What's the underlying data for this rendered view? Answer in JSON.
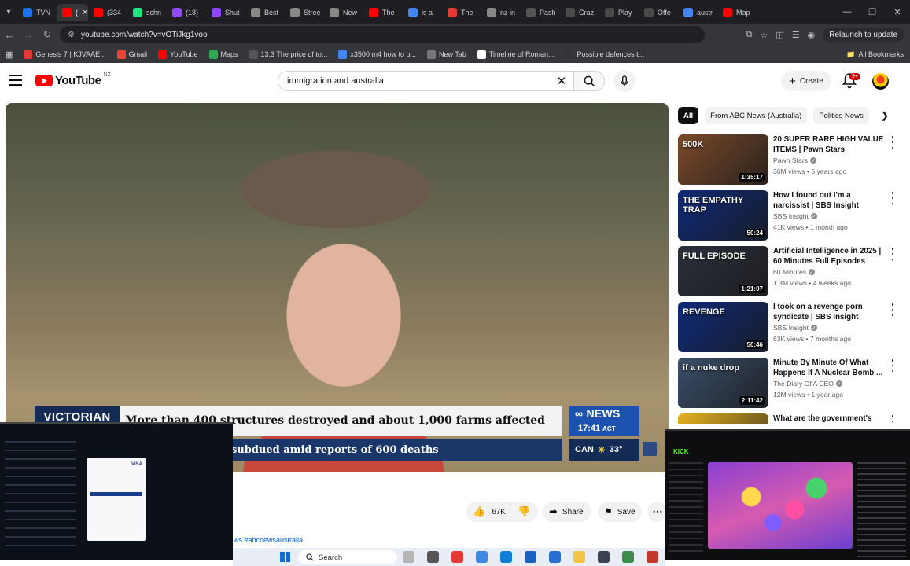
{
  "browser": {
    "tabs": [
      {
        "label": "TVN",
        "color": "#1a73e8"
      },
      {
        "label": "(",
        "color": "#ff0000",
        "active": true
      },
      {
        "label": "(334",
        "color": "#ff0000"
      },
      {
        "label": "schn",
        "color": "#1ce783"
      },
      {
        "label": "(18)",
        "color": "#9146ff"
      },
      {
        "label": "Shut",
        "color": "#9146ff"
      },
      {
        "label": "Best",
        "color": "#888888"
      },
      {
        "label": "Stree",
        "color": "#888888"
      },
      {
        "label": "New",
        "color": "#888888"
      },
      {
        "label": "The",
        "color": "#ff0000"
      },
      {
        "label": "is a",
        "color": "#4285f4"
      },
      {
        "label": "The",
        "color": "#e53935"
      },
      {
        "label": "nz in",
        "color": "#888888"
      },
      {
        "label": "Pash",
        "color": "#555555"
      },
      {
        "label": "Craz",
        "color": "#4a4a4a"
      },
      {
        "label": "Play",
        "color": "#4a4a4a"
      },
      {
        "label": "Offe",
        "color": "#4a4a4a"
      },
      {
        "label": "austr",
        "color": "#4285f4"
      },
      {
        "label": "Map",
        "color": "#ff0000"
      }
    ],
    "url": "youtube.com/watch?v=vOTiJkg1voo",
    "relaunch_label": "Relaunch to update",
    "bookmarks": [
      {
        "label": "Genesis 7 | KJVAAE...",
        "color": "#e53935"
      },
      {
        "label": "Gmail",
        "color": "#ea4335"
      },
      {
        "label": "YouTube",
        "color": "#ff0000"
      },
      {
        "label": "Maps",
        "color": "#34a853"
      },
      {
        "label": "13.3 The price of to...",
        "color": "#555555"
      },
      {
        "label": "x3500 m4 how to u...",
        "color": "#4285f4"
      },
      {
        "label": "New Tab",
        "color": "#777777"
      },
      {
        "label": "Timeline of Roman...",
        "color": "#ffffff"
      },
      {
        "label": "Possible defences t...",
        "color": "#333333"
      }
    ],
    "all_bookmarks_label": "All Bookmarks"
  },
  "youtube": {
    "logo_text": "YouTube",
    "region": "NZ",
    "search_value": "immigration and australia",
    "create_label": "Create",
    "notif_badge": "9+"
  },
  "player": {
    "lower_third_tag": "VICTORIAN",
    "headline": "More than 400 structures destroyed and about 1,000 farms affected",
    "subheadline": "subdued amid reports of 600 deaths",
    "brand": "NEWS",
    "time": "17:41",
    "timezone": "ACT",
    "weather_place": "CAN",
    "weather_temp": "33°"
  },
  "description": {
    "hashtags": "ws #abcnewsaustralia"
  },
  "actions": {
    "likes": "67K",
    "share_label": "Share",
    "save_label": "Save"
  },
  "chips": [
    {
      "label": "All",
      "active": true
    },
    {
      "label": "From ABC News (Australia)"
    },
    {
      "label": "Politics News"
    }
  ],
  "recommendations": [
    {
      "title": "20 SUPER RARE HIGH VALUE ITEMS | Pawn Stars",
      "channel": "Pawn Stars",
      "meta": "36M views • 5 years ago",
      "duration": "1:35:17",
      "thumb_text": "500K",
      "thumb_color": "#7a4a2a"
    },
    {
      "title": "How I found out I'm a narcissist | SBS Insight",
      "channel": "SBS Insight",
      "meta": "41K views • 1 month ago",
      "duration": "50:24",
      "thumb_text": "THE EMPATHY TRAP",
      "thumb_color": "#0e2a78"
    },
    {
      "title": "Artificial Intelligence in 2025 | 60 Minutes Full Episodes",
      "channel": "60 Minutes",
      "meta": "1.3M views • 4 weeks ago",
      "duration": "1:21:07",
      "thumb_text": "FULL EPISODE",
      "thumb_color": "#2a2f3a"
    },
    {
      "title": "I took on a revenge porn syndicate  | SBS Insight",
      "channel": "SBS Insight",
      "meta": "63K views • 7 months ago",
      "duration": "50:46",
      "thumb_text": "REVENGE",
      "thumb_color": "#0e2a78"
    },
    {
      "title": "Minute By Minute Of What Happens If A Nuclear Bomb ...",
      "channel": "The Diary Of A CEO",
      "meta": "12M views • 1 year ago",
      "duration": "2:11:42",
      "thumb_text": "if a nuke drop",
      "thumb_color": "#3a4f6a"
    },
    {
      "title": "What are the government's",
      "channel": "",
      "meta": "",
      "duration": "",
      "thumb_text": "",
      "thumb_color": "#e8b320"
    }
  ],
  "overlays": {
    "left_card_brand": "VISA",
    "right_brand": "KICK"
  },
  "taskbar": {
    "search_label": "Search",
    "apps": [
      {
        "name": "widgets-icon",
        "color": "#b5b5b5"
      },
      {
        "name": "task-view-icon",
        "color": "#555555"
      },
      {
        "name": "chrome-icon",
        "color": "#e53935"
      },
      {
        "name": "photos-icon",
        "color": "#3f88e4"
      },
      {
        "name": "edge-icon",
        "color": "#0e7fd6"
      },
      {
        "name": "outlook-icon",
        "color": "#1a5fc0"
      },
      {
        "name": "store-icon",
        "color": "#2a6fcf"
      },
      {
        "name": "explorer-icon",
        "color": "#f4c542"
      },
      {
        "name": "calculator-icon",
        "color": "#3b4250"
      },
      {
        "name": "app-icon",
        "color": "#3f8a4f"
      },
      {
        "name": "active-app-icon",
        "color": "#c0392b"
      }
    ]
  }
}
